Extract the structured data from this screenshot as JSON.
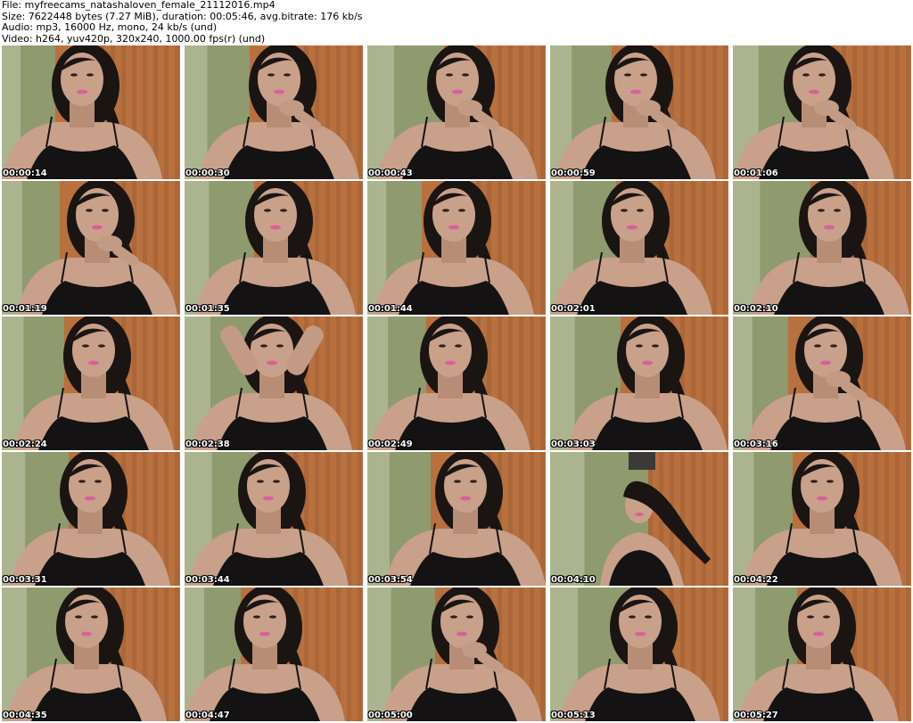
{
  "header": {
    "file_line": "File: myfreecams_natashaloven_female_21112016.mp4",
    "size_line": "Size: 7622448 bytes (7.27 MiB), duration: 00:05:46, avg.bitrate: 176 kb/s",
    "audio_line": "Audio: mp3, 16000 Hz, mono, 24 kb/s (und)",
    "video_line": "Video: h264, yuv420p, 320x240, 1000.00 fps(r) (und)"
  },
  "thumbnails": [
    {
      "timestamp": "00:00:14"
    },
    {
      "timestamp": "00:00:30"
    },
    {
      "timestamp": "00:00:43"
    },
    {
      "timestamp": "00:00:59"
    },
    {
      "timestamp": "00:01:06"
    },
    {
      "timestamp": "00:01:19"
    },
    {
      "timestamp": "00:01:35"
    },
    {
      "timestamp": "00:01:44"
    },
    {
      "timestamp": "00:02:01"
    },
    {
      "timestamp": "00:02:10"
    },
    {
      "timestamp": "00:02:24"
    },
    {
      "timestamp": "00:02:38"
    },
    {
      "timestamp": "00:02:49"
    },
    {
      "timestamp": "00:03:03"
    },
    {
      "timestamp": "00:03:16"
    },
    {
      "timestamp": "00:03:31"
    },
    {
      "timestamp": "00:03:44"
    },
    {
      "timestamp": "00:03:54"
    },
    {
      "timestamp": "00:04:10"
    },
    {
      "timestamp": "00:04:22"
    },
    {
      "timestamp": "00:04:35"
    },
    {
      "timestamp": "00:04:47"
    },
    {
      "timestamp": "00:05:00"
    },
    {
      "timestamp": "00:05:13"
    },
    {
      "timestamp": "00:05:27"
    }
  ],
  "colors": {
    "wall_green": "#8f9a6e",
    "curtain_orange": "#b8703f",
    "skin": "#c9a08a",
    "hair": "#1a1512",
    "top_black": "#141212",
    "lips": "#d9609a"
  }
}
